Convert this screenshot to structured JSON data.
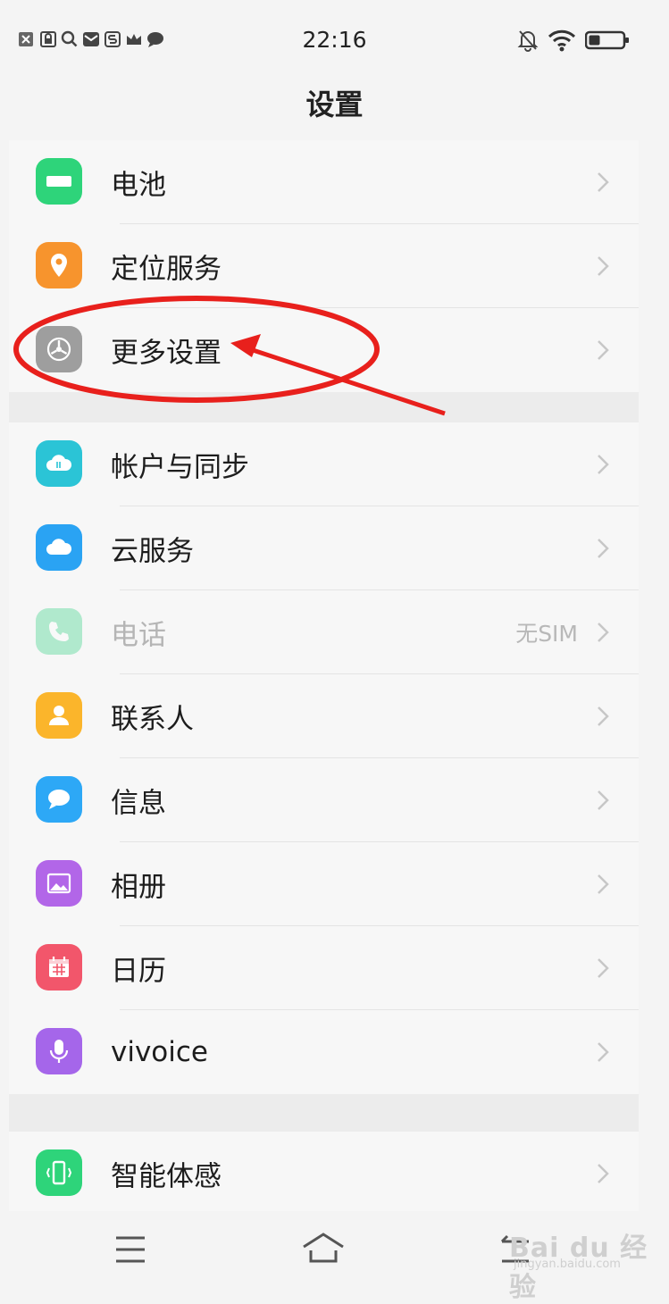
{
  "status_bar": {
    "time": "22:16",
    "left_icons": [
      "close-box-icon",
      "lock-notice-icon",
      "search-icon",
      "mail-icon",
      "s-app-icon",
      "crown-icon",
      "chat-bubble-icon"
    ],
    "right_icons": [
      "mute-bell-icon",
      "wifi-icon",
      "battery-icon"
    ]
  },
  "header": {
    "title": "设置"
  },
  "groups": [
    {
      "items": [
        {
          "label": "电池",
          "icon": "battery-icon",
          "color": "#2ed47a"
        },
        {
          "label": "定位服务",
          "icon": "location-pin-icon",
          "color": "#f7942d"
        },
        {
          "label": "更多设置",
          "icon": "gear-icon",
          "color": "#9e9e9e"
        }
      ]
    },
    {
      "items": [
        {
          "label": "帐户与同步",
          "icon": "cloud-sync-icon",
          "color": "#2bc4d6"
        },
        {
          "label": "云服务",
          "icon": "cloud-icon",
          "color": "#2aa3f3"
        },
        {
          "label": "电话",
          "icon": "phone-icon",
          "color": "#2fd082",
          "value": "无SIM",
          "disabled": true
        },
        {
          "label": "联系人",
          "icon": "contact-icon",
          "color": "#fbb52b"
        },
        {
          "label": "信息",
          "icon": "message-icon",
          "color": "#2da8f6"
        },
        {
          "label": "相册",
          "icon": "photo-icon",
          "color": "#b266e8"
        },
        {
          "label": "日历",
          "icon": "calendar-icon",
          "color": "#f2566b"
        },
        {
          "label": "vivoice",
          "icon": "microphone-icon",
          "color": "#a566ea"
        }
      ]
    },
    {
      "items": [
        {
          "label": "智能体感",
          "icon": "smart-motion-icon",
          "color": "#2ed47a"
        }
      ]
    }
  ],
  "nav_bar": {
    "icons": [
      "menu-icon",
      "home-icon",
      "back-icon"
    ]
  },
  "annotation": {
    "color": "#e8201c"
  },
  "watermark": {
    "text": "Bai du 经验",
    "sub": "jingyan.baidu.com"
  }
}
